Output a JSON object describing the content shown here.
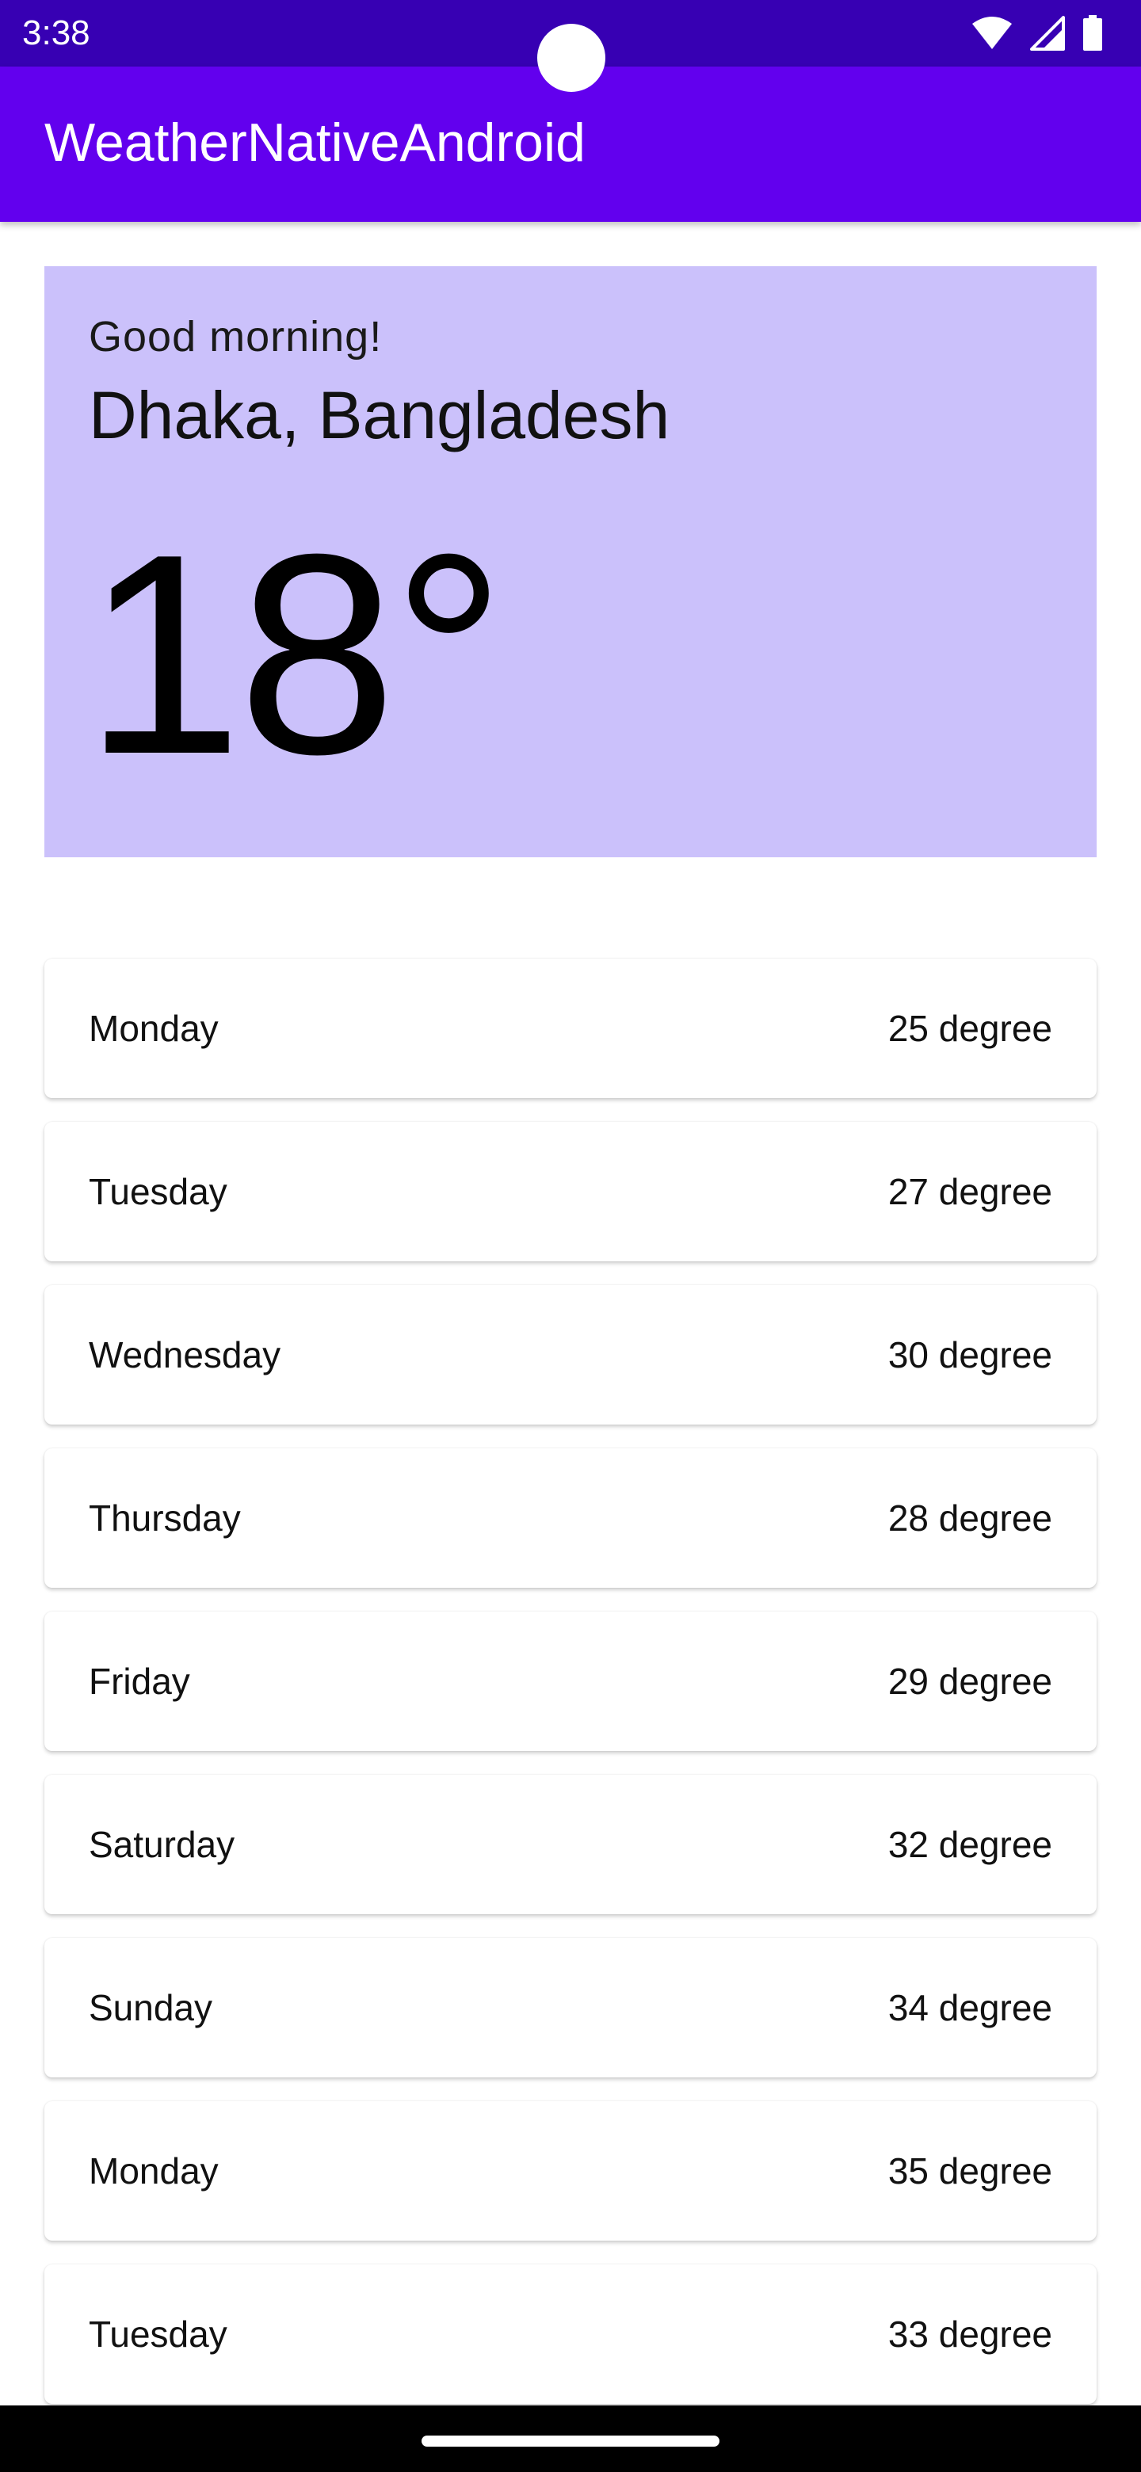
{
  "status_bar": {
    "time": "3:38",
    "icons": [
      "wifi-icon",
      "cell-signal-icon",
      "battery-icon"
    ]
  },
  "app_bar": {
    "title": "WeatherNativeAndroid"
  },
  "hero": {
    "greeting": "Good morning!",
    "location": "Dhaka, Bangladesh",
    "temperature": "18°"
  },
  "forecast": [
    {
      "day": "Monday",
      "temp": "25 degree"
    },
    {
      "day": "Tuesday",
      "temp": "27 degree"
    },
    {
      "day": "Wednesday",
      "temp": "30 degree"
    },
    {
      "day": "Thursday",
      "temp": "28 degree"
    },
    {
      "day": "Friday",
      "temp": "29 degree"
    },
    {
      "day": "Saturday",
      "temp": "32 degree"
    },
    {
      "day": "Sunday",
      "temp": "34 degree"
    },
    {
      "day": "Monday",
      "temp": "35 degree"
    },
    {
      "day": "Tuesday",
      "temp": "33 degree"
    }
  ],
  "colors": {
    "status_bar": "#3700b3",
    "app_bar": "#6200ee",
    "hero_background": "#cbc1fb"
  }
}
